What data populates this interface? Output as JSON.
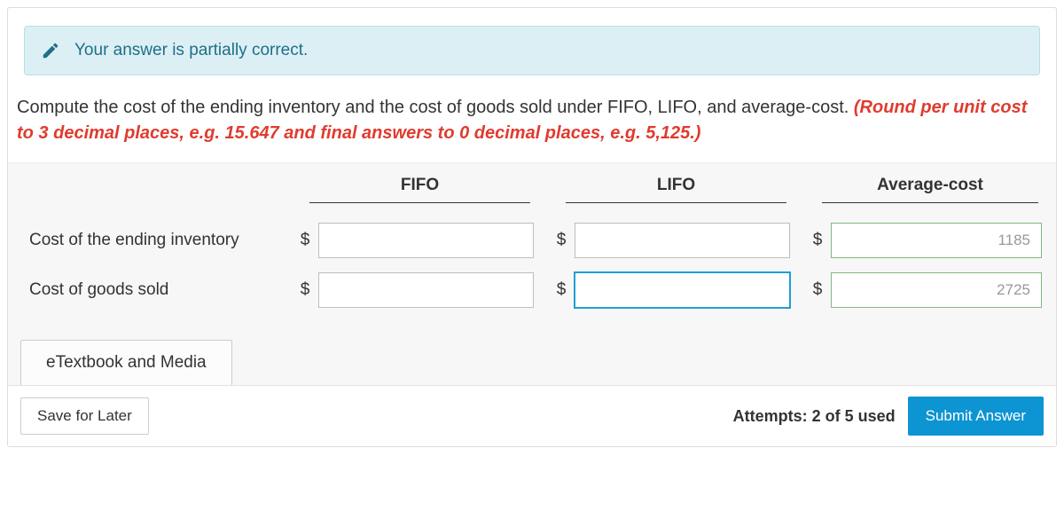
{
  "alert": {
    "text": "Your answer is partially correct."
  },
  "question": {
    "main": "Compute the cost of the ending inventory and the cost of goods sold under FIFO, LIFO, and average-cost. ",
    "hint": "(Round per unit cost to 3 decimal places, e.g. 15.647 and final answers to 0 decimal places, e.g. 5,125.)"
  },
  "columns": {
    "fifo": "FIFO",
    "lifo": "LIFO",
    "avg": "Average-cost"
  },
  "rows": {
    "ending": {
      "label": "Cost of the ending inventory",
      "currency": "$",
      "fifo": "",
      "lifo": "",
      "avg": "1185"
    },
    "cogs": {
      "label": "Cost of goods sold",
      "currency": "$",
      "fifo": "",
      "lifo": "",
      "avg": "2725"
    }
  },
  "resources": {
    "etextbook": "eTextbook and Media"
  },
  "footer": {
    "save": "Save for Later",
    "attempts": "Attempts: 2 of 5 used",
    "submit": "Submit Answer"
  }
}
